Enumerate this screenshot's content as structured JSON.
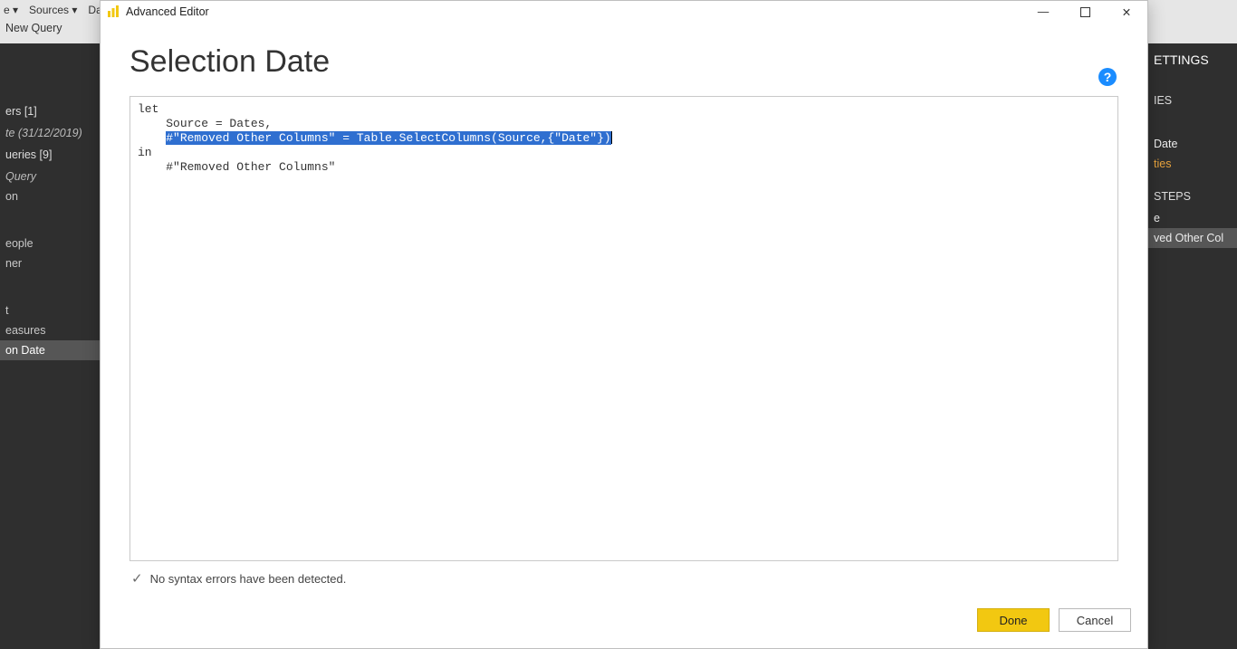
{
  "ribbon": {
    "items": [
      "e ▾",
      "Sources ▾",
      "Dat"
    ],
    "new_query": "New Query"
  },
  "left_panel": {
    "group1_header": "ers [1]",
    "group1_item": "te (31/12/2019)",
    "group2_header": "ueries [9]",
    "items": [
      "Query",
      "on",
      "eople",
      "ner",
      "t",
      "easures"
    ],
    "selected": "on Date"
  },
  "right_panel": {
    "settings": "ETTINGS",
    "properties_hdr": "IES",
    "name_value": "Date",
    "properties_link": "ties",
    "steps_hdr": "STEPS",
    "step1": "e",
    "step2": "ved Other Col"
  },
  "modal": {
    "title": "Advanced Editor",
    "query_name": "Selection Date",
    "help_glyph": "?",
    "code": {
      "line1": "let",
      "line2_indent": "    ",
      "line2": "Source = Dates,",
      "line3_indent": "    ",
      "line3_sel": "#\"Removed Other Columns\" = Table.SelectColumns(Source,{\"Date\"})",
      "line4": "in",
      "line5_indent": "    ",
      "line5": "#\"Removed Other Columns\""
    },
    "status_text": "No syntax errors have been detected.",
    "done_label": "Done",
    "cancel_label": "Cancel"
  },
  "window_controls": {
    "min": "—",
    "max": "▢",
    "close": "✕"
  }
}
